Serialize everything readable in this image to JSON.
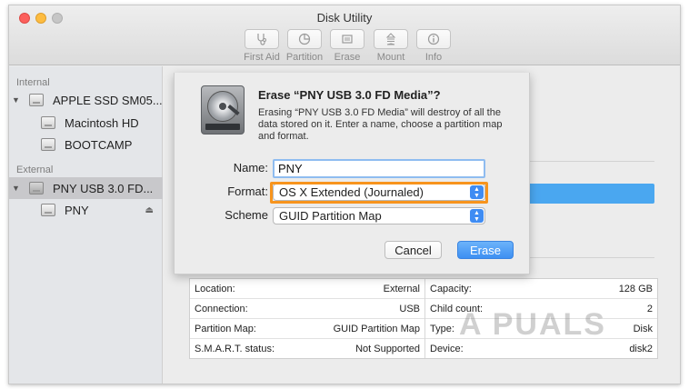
{
  "window": {
    "title": "Disk Utility"
  },
  "toolbar": {
    "items": [
      {
        "label": "First Aid",
        "icon": "stethoscope-icon"
      },
      {
        "label": "Partition",
        "icon": "pie-icon"
      },
      {
        "label": "Erase",
        "icon": "erase-icon"
      },
      {
        "label": "Mount",
        "icon": "mount-icon"
      },
      {
        "label": "Info",
        "icon": "info-icon"
      }
    ]
  },
  "sidebar": {
    "internal_heading": "Internal",
    "external_heading": "External",
    "items": [
      {
        "label": "APPLE SSD SM05..."
      },
      {
        "label": "Macintosh HD"
      },
      {
        "label": "BOOTCAMP"
      },
      {
        "label": "PNY USB 3.0 FD..."
      },
      {
        "label": "PNY"
      }
    ]
  },
  "dialog": {
    "title": "Erase “PNY USB 3.0 FD Media”?",
    "message": "Erasing “PNY USB 3.0 FD Media” will destroy of all the data stored on it. Enter a name, choose a partition map and format.",
    "name_label": "Name:",
    "name_value": "PNY",
    "format_label": "Format:",
    "format_value": "OS X Extended (Journaled)",
    "scheme_label": "Scheme",
    "scheme_value": "GUID Partition Map",
    "cancel_label": "Cancel",
    "erase_label": "Erase"
  },
  "info": {
    "left": [
      {
        "key": "Location:",
        "value": "External"
      },
      {
        "key": "Connection:",
        "value": "USB"
      },
      {
        "key": "Partition Map:",
        "value": "GUID Partition Map"
      },
      {
        "key": "S.M.A.R.T. status:",
        "value": "Not Supported"
      }
    ],
    "right": [
      {
        "key": "Capacity:",
        "value": "128 GB"
      },
      {
        "key": "Child count:",
        "value": "2"
      },
      {
        "key": "Type:",
        "value": "Disk"
      },
      {
        "key": "Device:",
        "value": "disk2"
      }
    ]
  },
  "watermark": "A PUALS",
  "colors": {
    "accent": "#3f8cf3",
    "highlight": "#f7941d",
    "selection": "#4aa7f0"
  }
}
